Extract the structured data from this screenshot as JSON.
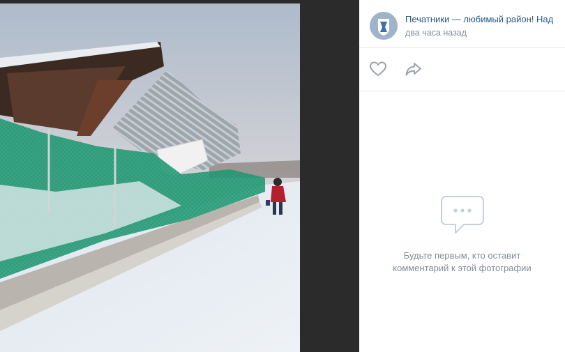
{
  "post": {
    "author": "Печатники — любимый район! Над",
    "time": "два часа назад"
  },
  "actions": {
    "like_icon": "heart-icon",
    "share_icon": "share-arrow-icon"
  },
  "comments": {
    "empty_icon": "comment-bubble-icon",
    "empty_line1": "Будьте первым, кто оставит",
    "empty_line2": "комментарий к этой фотографии"
  },
  "colors": {
    "link": "#2a5885",
    "muted": "#818c99",
    "icon": "#99a2ad",
    "backdrop": "#2b2b2b"
  }
}
